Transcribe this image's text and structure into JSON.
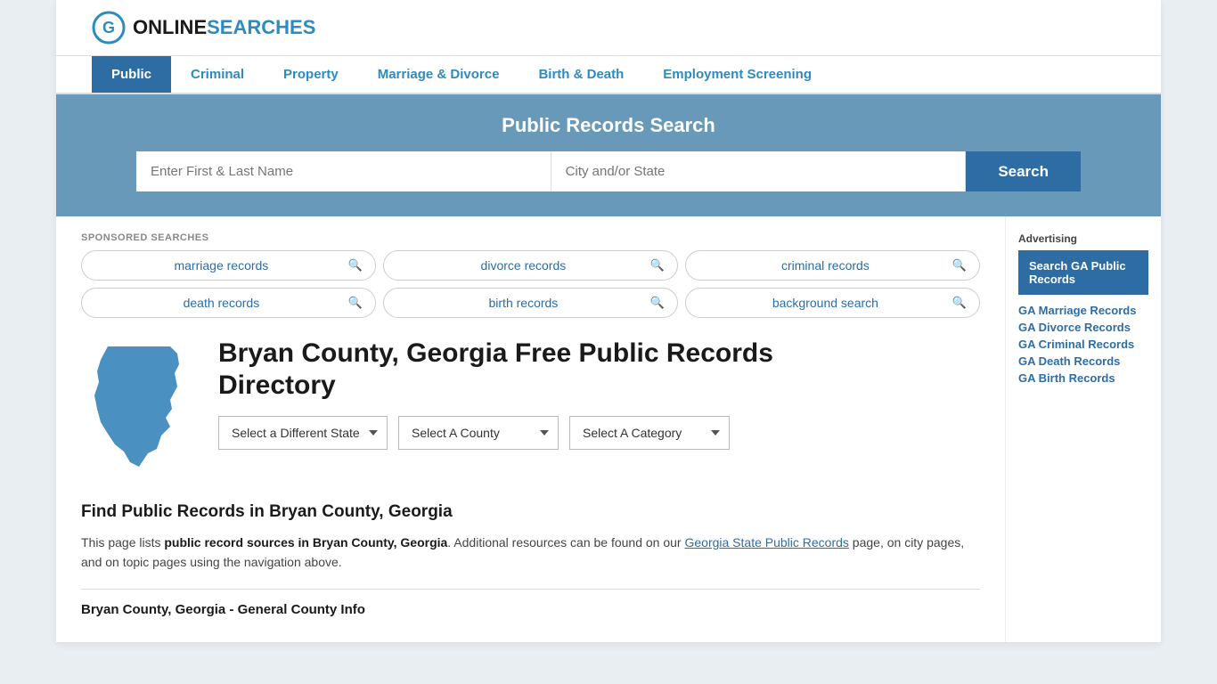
{
  "logo": {
    "text_online": "ONLINE",
    "text_searches": "SEARCHES"
  },
  "nav": {
    "items": [
      {
        "label": "Public",
        "active": true
      },
      {
        "label": "Criminal",
        "active": false
      },
      {
        "label": "Property",
        "active": false
      },
      {
        "label": "Marriage & Divorce",
        "active": false
      },
      {
        "label": "Birth & Death",
        "active": false
      },
      {
        "label": "Employment Screening",
        "active": false
      }
    ]
  },
  "search_banner": {
    "title": "Public Records Search",
    "name_placeholder": "Enter First & Last Name",
    "city_placeholder": "City and/or State",
    "button_label": "Search"
  },
  "sponsored": {
    "label": "SPONSORED SEARCHES",
    "items": [
      "marriage records",
      "divorce records",
      "criminal records",
      "death records",
      "birth records",
      "background search"
    ]
  },
  "state_section": {
    "title_line1": "Bryan County, Georgia Free Public Records",
    "title_line2": "Directory"
  },
  "dropdowns": {
    "state_label": "Select a Different State",
    "county_label": "Select A County",
    "category_label": "Select A Category"
  },
  "find_section": {
    "title": "Find Public Records in Bryan County, Georgia",
    "text_start": "This page lists ",
    "text_bold": "public record sources in Bryan County, Georgia",
    "text_mid": ". Additional resources can be found on our ",
    "link_text": "Georgia State Public Records",
    "text_end": " page, on city pages, and on topic pages using the navigation above."
  },
  "county_info": {
    "heading": "Bryan County, Georgia - General County Info"
  },
  "sidebar": {
    "ad_label": "Advertising",
    "ad_box_text": "Search GA Public Records",
    "links": [
      "GA Marriage Records",
      "GA Divorce Records",
      "GA Criminal Records",
      "GA Death Records",
      "GA Birth Records"
    ]
  }
}
